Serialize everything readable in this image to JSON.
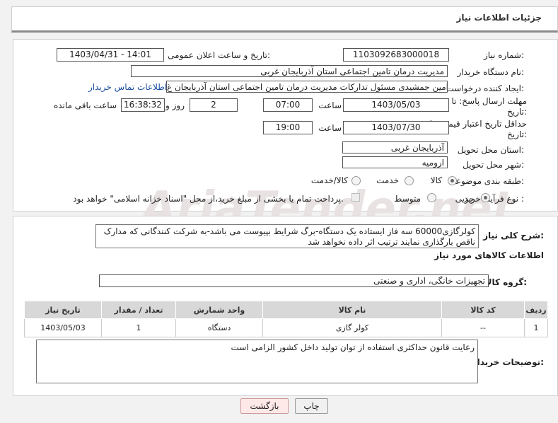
{
  "header": {
    "title": "جزئیات اطلاعات نیاز"
  },
  "form": {
    "need_number_label": "شماره نیاز:",
    "need_number_value": "1103092683000018",
    "announce_label": "تاریخ و ساعت اعلان عمومی:",
    "announce_value": "1403/04/31 - 14:01",
    "buyer_org_label": "نام دستگاه خریدار:",
    "buyer_org_value": "مدیریت درمان تامین اجتماعی استان آذربایجان غربی",
    "creator_label": "ایجاد کننده درخواست:",
    "creator_value": "امین جمشیدی مسئول تدارکات مدیریت درمان تامین اجتماعی استان آذربایجان غ",
    "contact_link": "اطلاعات تماس خریدار",
    "deadline_label_1": "مهلت ارسال پاسخ: تا",
    "deadline_label_2": "تاریخ:",
    "deadline_date": "1403/05/03",
    "time_label": "ساعت",
    "deadline_time": "07:00",
    "days_value": "2",
    "days_label": "روز و",
    "remaining_value": "16:38:32",
    "remaining_label": "ساعت باقی مانده",
    "validity_label_1": "حداقل تاریخ اعتبار قیمت: تا",
    "validity_label_2": "تاریخ:",
    "validity_date": "1403/07/30",
    "validity_time": "19:00",
    "province_label": "استان محل تحویل:",
    "province_value": "آذربایجان غربی",
    "city_label": "شهر محل تحویل:",
    "city_value": "ارومیه",
    "category_label": "طبقه بندی موضوعی:",
    "category_options": [
      "کالا",
      "خدمت",
      "کالا/خدمت"
    ],
    "category_selected": "کالا",
    "process_label": "نوع فرآیند خرید :",
    "process_options": [
      "جزیی",
      "متوسط"
    ],
    "process_selected": "جزیی",
    "payment_note": "پرداخت تمام یا بخشی از مبلغ خرید،از محل \"اسناد خزانه اسلامی\" خواهد بود."
  },
  "description": {
    "label": "شرح کلی نیاز:",
    "text": "کولرگازی60000 سه فاز ایستاده یک دستگاه-برگ شرایط بپیوست می باشد-به شرکت کنندگانی که مدارک ناقص بارگذاری نمایند ترتیب اثر داده نخواهد شد"
  },
  "goods": {
    "section_title": "اطلاعات کالاهای مورد نیاز",
    "group_label": "گروه کالا:",
    "group_value": "تجهیزات خانگی، اداری و صنعتی",
    "table": {
      "headers": [
        "ردیف",
        "کد کالا",
        "نام کالا",
        "واحد شمارش",
        "تعداد / مقدار",
        "تاریخ نیاز"
      ],
      "rows": [
        [
          "1",
          "--",
          "کولر گازی",
          "دستگاه",
          "1",
          "1403/05/03"
        ]
      ]
    }
  },
  "buyer_notes": {
    "label": "توضیحات خریدار:",
    "text": "رعایت قانون حداکثری استفاده از توان تولید داخل کشور الزامی است"
  },
  "buttons": {
    "print": "چاپ",
    "back": "بازگشت"
  },
  "watermark": "AriaTender.net"
}
